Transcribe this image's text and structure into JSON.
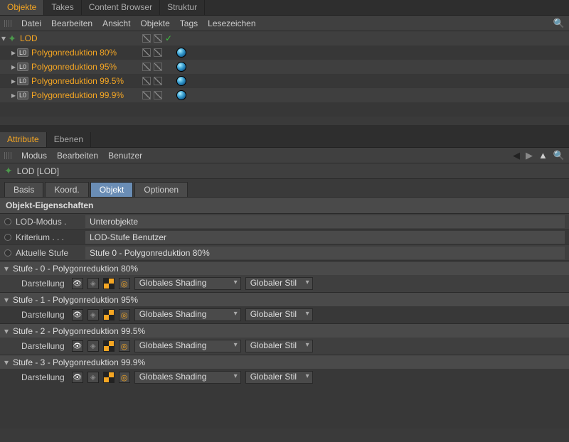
{
  "top_tabs": {
    "objects": "Objekte",
    "takes": "Takes",
    "content_browser": "Content Browser",
    "structure": "Struktur"
  },
  "obj_menu": {
    "file": "Datei",
    "edit": "Bearbeiten",
    "view": "Ansicht",
    "objects": "Objekte",
    "tags": "Tags",
    "bookmarks": "Lesezeichen"
  },
  "tree": {
    "root": "LOD",
    "children": [
      "Polygonreduktion 80%",
      "Polygonreduktion 95%",
      "Polygonreduktion 99.5%",
      "Polygonreduktion 99.9%"
    ],
    "badge": "L0"
  },
  "attr_tabs": {
    "attributes": "Attribute",
    "layers": "Ebenen"
  },
  "attr_menu": {
    "mode": "Modus",
    "edit": "Bearbeiten",
    "user": "Benutzer"
  },
  "attr_title": "LOD [LOD]",
  "sub_tabs": {
    "basis": "Basis",
    "coord": "Koord.",
    "object": "Objekt",
    "options": "Optionen"
  },
  "section_title": "Objekt-Eigenschaften",
  "props": {
    "lod_mode_label": "LOD-Modus .",
    "lod_mode_value": "Unterobjekte",
    "criterion_label": "Kriterium  . . .",
    "criterion_value": "LOD-Stufe Benutzer",
    "current_label": "Aktuelle Stufe",
    "current_value": "Stufe 0 - Polygonreduktion 80%"
  },
  "stages": [
    {
      "title": "Stufe - 0 - Polygonreduktion 80%"
    },
    {
      "title": "Stufe - 1 - Polygonreduktion 95%"
    },
    {
      "title": "Stufe - 2 - Polygonreduktion 99.5%"
    },
    {
      "title": "Stufe - 3 - Polygonreduktion 99.9%"
    }
  ],
  "stage_common": {
    "display_label": "Darstellung",
    "shading": "Globales Shading",
    "style": "Globaler Stil"
  }
}
